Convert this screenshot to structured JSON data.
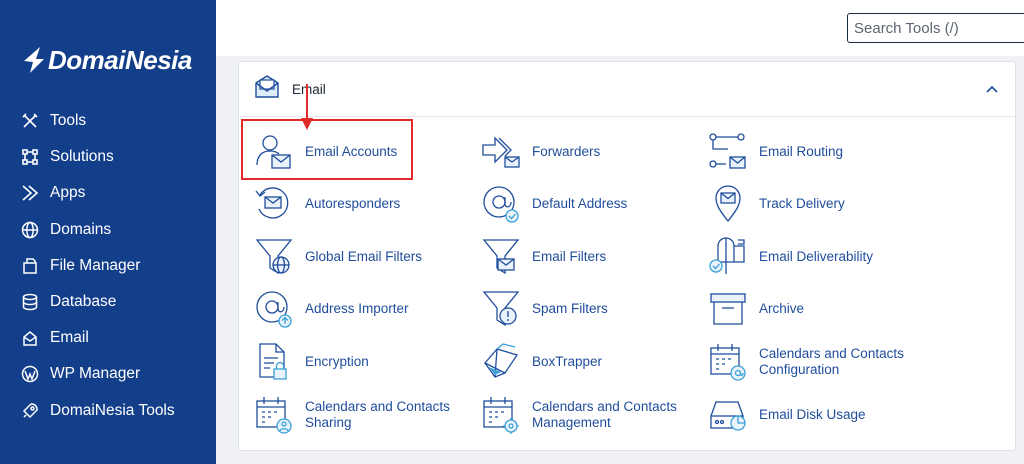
{
  "brand": {
    "name": "DomaiNesia"
  },
  "sidebar": {
    "items": [
      {
        "label": "Tools",
        "icon": "tools-icon"
      },
      {
        "label": "Solutions",
        "icon": "solutions-icon"
      },
      {
        "label": "Apps",
        "icon": "apps-icon"
      },
      {
        "label": "Domains",
        "icon": "globe-icon"
      },
      {
        "label": "File Manager",
        "icon": "file-manager-icon"
      },
      {
        "label": "Database",
        "icon": "database-icon"
      },
      {
        "label": "Email",
        "icon": "email-icon"
      },
      {
        "label": "WP Manager",
        "icon": "wordpress-icon"
      },
      {
        "label": "DomaiNesia Tools",
        "icon": "rocket-icon"
      }
    ]
  },
  "search": {
    "placeholder": "Search Tools (/)"
  },
  "panel": {
    "title": "Email",
    "tools": [
      [
        "Email Accounts",
        "Forwarders",
        "Email Routing"
      ],
      [
        "Autoresponders",
        "Default Address",
        "Track Delivery"
      ],
      [
        "Global Email Filters",
        "Email Filters",
        "Email Deliverability"
      ],
      [
        "Address Importer",
        "Spam Filters",
        "Archive"
      ],
      [
        "Encryption",
        "BoxTrapper",
        "Calendars and Contacts Configuration"
      ],
      [
        "Calendars and Contacts Sharing",
        "Calendars and Contacts Management",
        "Email Disk Usage"
      ]
    ]
  },
  "colors": {
    "sidebar": "#133e8a",
    "link": "#1f4d9c",
    "highlight": "#e32a2a",
    "icon_accent": "#3aa0d8"
  }
}
